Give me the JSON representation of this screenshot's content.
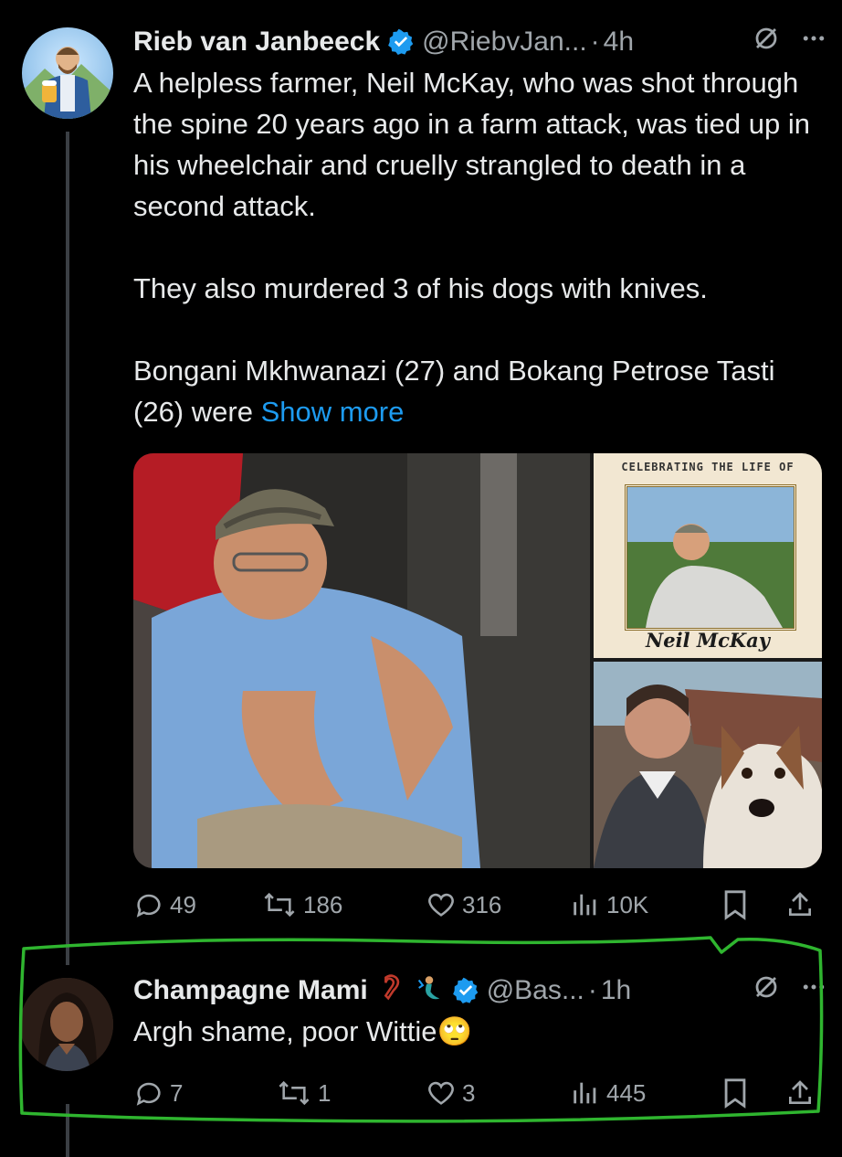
{
  "post1": {
    "author_name": "Rieb van Janbeeck",
    "handle": "@RiebvJan...",
    "time": "4h",
    "paragraphs": [
      "A helpless farmer, Neil McKay, who was shot through the spine 20 years ago in a farm attack, was tied up in his wheelchair and cruelly strangled to death in a second attack.",
      "They also murdered 3 of his dogs with knives.",
      "Bongani Mkhwanazi (27) and Bokang Petrose Tasti (26) were"
    ],
    "show_more": "Show more",
    "media": {
      "memorial_caption": "CELEBRATING THE LIFE OF",
      "memorial_name": "Neil McKay"
    },
    "stats": {
      "replies": "49",
      "reposts": "186",
      "likes": "316",
      "views": "10K"
    }
  },
  "post2": {
    "author_name": "Champagne Mami",
    "handle": "@Bas...",
    "time": "1h",
    "text": "Argh shame, poor Wittie",
    "emoji": "🙄",
    "stats": {
      "replies": "7",
      "reposts": "1",
      "likes": "3",
      "views": "445"
    }
  },
  "ui": {
    "dot": "·",
    "accent": "#1d9bf0",
    "highlight_color": "#2fb52f",
    "icons": [
      "verified-icon",
      "grok-icon",
      "more-icon",
      "reply-icon",
      "repost-icon",
      "like-icon",
      "views-icon",
      "bookmark-icon",
      "share-icon"
    ]
  }
}
